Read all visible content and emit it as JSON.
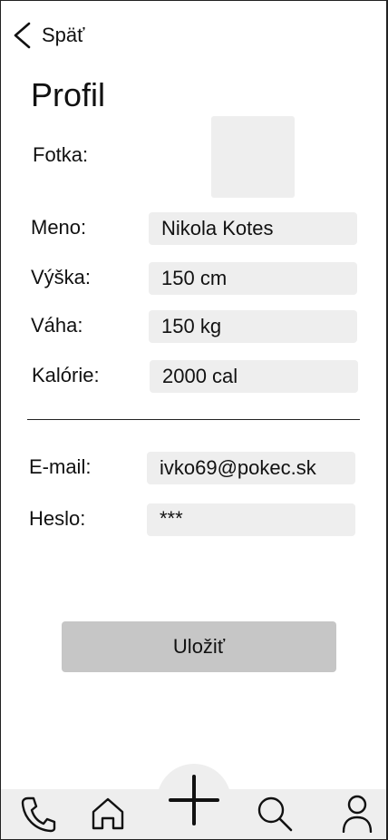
{
  "header": {
    "back_label": "Späť",
    "title": "Profil"
  },
  "profile": {
    "photo_label": "Fotka:",
    "name_label": "Meno:",
    "name_value": "Nikola Kotes",
    "height_label": "Výška:",
    "height_value": "150 cm",
    "weight_label": "Váha:",
    "weight_value": "150 kg",
    "calories_label": "Kalórie:",
    "calories_value": "2000 cal"
  },
  "account": {
    "email_label": "E-mail:",
    "email_value": "ivko69@pokec.sk",
    "password_label": "Heslo:",
    "password_value": "***"
  },
  "actions": {
    "save_label": "Uložiť"
  },
  "bottom_nav": {
    "items": [
      "phone-icon",
      "home-icon",
      "add-icon",
      "search-icon",
      "user-icon"
    ]
  },
  "colors": {
    "field_bg": "#eeeeee",
    "button_bg": "#c6c6c6",
    "nav_bg": "#eeeeee"
  }
}
